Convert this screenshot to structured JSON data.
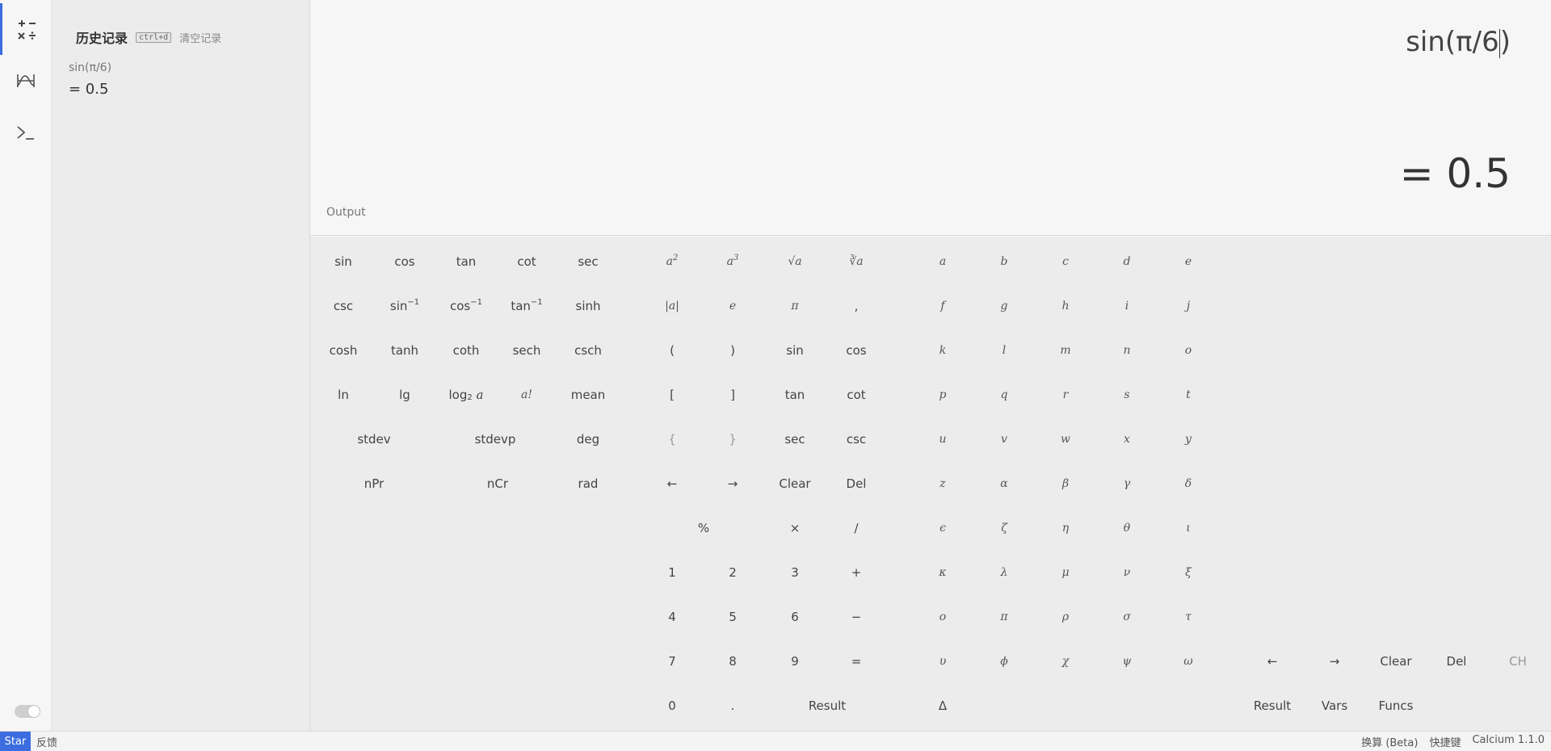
{
  "rail": {
    "items": [
      {
        "name": "calculator-icon"
      },
      {
        "name": "graph-icon"
      },
      {
        "name": "terminal-icon"
      }
    ]
  },
  "history": {
    "title": "历史记录",
    "shortcut": "ctrl+d",
    "clear_label": "清空记录",
    "entries": [
      {
        "expression": "sin(π/6)",
        "result": "= 0.5"
      }
    ]
  },
  "output": {
    "expression_before_caret": "sin(π/6",
    "expression_after_caret": ")",
    "result": "= 0.5",
    "label": "Output"
  },
  "keypad": {
    "functions": {
      "row1": [
        "sin",
        "cos",
        "tan",
        "cot",
        "sec"
      ],
      "row2_plain": [
        "csc",
        "sinh"
      ],
      "row2_inverse": [
        "sin",
        "cos",
        "tan"
      ],
      "inverse_sup": "−1",
      "row3": [
        "cosh",
        "tanh",
        "coth",
        "sech",
        "csch"
      ],
      "row4_plain": [
        "ln",
        "lg",
        "mean"
      ],
      "log_base": "log",
      "log_sub": "2",
      "log_arg": "a",
      "factorial": "a!",
      "row5": [
        "stdev",
        "stdevp",
        "deg"
      ],
      "row6": [
        "nPr",
        "nCr",
        "rad"
      ]
    },
    "operators": {
      "square": "a",
      "square_sup": "2",
      "cube": "a",
      "cube_sup": "3",
      "sqrt": "√a",
      "cbrt": "∛a",
      "abs": "|a|",
      "e": "e",
      "pi": "π",
      "comma": ",",
      "row3": [
        "(",
        ")",
        "sin",
        "cos"
      ],
      "row4": [
        "[",
        "]",
        "tan",
        "cot"
      ],
      "row5": [
        "{",
        "}",
        "sec",
        "csc"
      ],
      "row6": [
        "←",
        "→",
        "Clear",
        "Del"
      ],
      "row7": [
        "%",
        "×",
        "/"
      ],
      "row8": [
        "1",
        "2",
        "3",
        "+"
      ],
      "row9": [
        "4",
        "5",
        "6",
        "−"
      ],
      "row10": [
        "7",
        "8",
        "9",
        "="
      ],
      "row11": [
        "0",
        ".",
        "Result"
      ]
    },
    "letters": {
      "rows": [
        [
          "a",
          "b",
          "c",
          "d",
          "e"
        ],
        [
          "f",
          "g",
          "h",
          "i",
          "j"
        ],
        [
          "k",
          "l",
          "m",
          "n",
          "o"
        ],
        [
          "p",
          "q",
          "r",
          "s",
          "t"
        ],
        [
          "u",
          "v",
          "w",
          "x",
          "y"
        ],
        [
          "z",
          "α",
          "β",
          "γ",
          "δ"
        ],
        [
          "ϵ",
          "ζ",
          "η",
          "θ",
          "ι"
        ],
        [
          "κ",
          "λ",
          "μ",
          "ν",
          "ξ"
        ],
        [
          "ο",
          "π",
          "ρ",
          "σ",
          "τ"
        ],
        [
          "υ",
          "ϕ",
          "χ",
          "ψ",
          "ω"
        ]
      ],
      "delta": "Δ"
    },
    "edit": {
      "row1": [
        "←",
        "→",
        "Clear",
        "Del",
        "CH"
      ],
      "row2": [
        "Result",
        "Vars",
        "Funcs"
      ]
    }
  },
  "statusbar": {
    "star": "Star",
    "feedback": "反馈",
    "right": [
      "换算 (Beta)",
      "快捷键",
      "Calcium 1.1.0"
    ]
  }
}
